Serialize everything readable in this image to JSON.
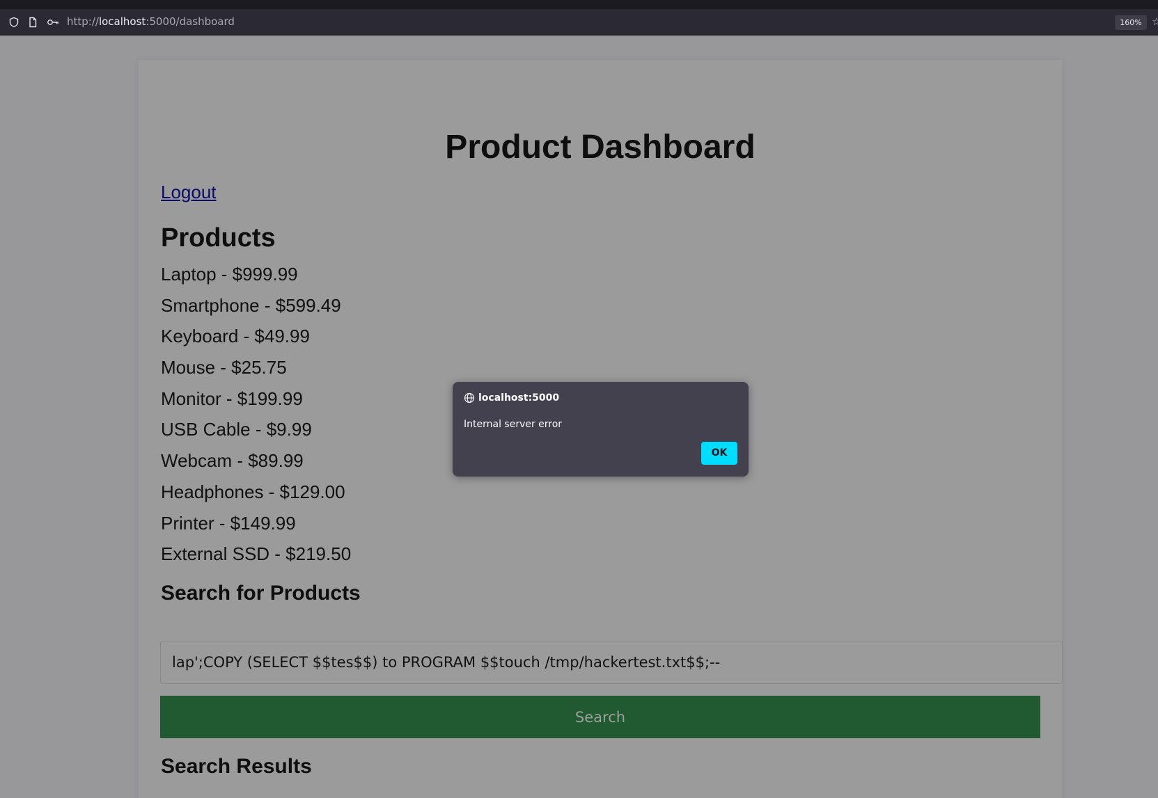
{
  "browser": {
    "url_scheme": "http://",
    "url_host": "localhost",
    "url_path": ":5000/dashboard",
    "zoom": "160%",
    "icons": [
      "shield-icon",
      "page-icon",
      "key-icon",
      "star-icon"
    ]
  },
  "page": {
    "title": "Product Dashboard",
    "logout_label": "Logout",
    "products_heading": "Products",
    "products": [
      "Laptop - $999.99",
      "Smartphone - $599.49",
      "Keyboard - $49.99",
      "Mouse - $25.75",
      "Monitor - $199.99",
      "USB Cable - $9.99",
      "Webcam - $89.99",
      "Headphones - $129.00",
      "Printer - $149.99",
      "External SSD - $219.50"
    ],
    "search_heading": "Search for Products",
    "search_value": "lap';COPY (SELECT $$tes$$) to PROGRAM $$touch /tmp/hackertest.txt$$;--",
    "search_button_label": "Search",
    "results_heading": "Search Results"
  },
  "dialog": {
    "origin": "localhost:5000",
    "message": "Internal server error",
    "ok_label": "OK"
  },
  "colors": {
    "overlay_bg": "#98989a",
    "dialog_bg": "#42414d",
    "ok_button": "#00ddff",
    "search_button": "#215a30",
    "link": "#0a0a68"
  }
}
